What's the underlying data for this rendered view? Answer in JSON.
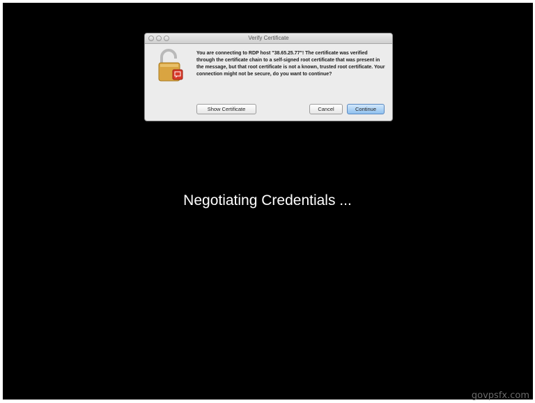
{
  "dialog": {
    "title": "Verify Certificate",
    "message": "You are connecting to RDP host \"38.65.25.77\"! The certificate was verified through the certificate chain to a self-signed root certificate that was present in the message, but that root certificate is not a known, trusted root certificate. Your connection might not be secure, do you want to continue?",
    "show_certificate_label": "Show Certificate",
    "cancel_label": "Cancel",
    "continue_label": "Continue",
    "icon": "unlocked-padlock-certificate-icon"
  },
  "status_text": "Negotiating Credentials ...",
  "watermark": "govpsfx.com",
  "colors": {
    "background": "#000000",
    "dialog_bg": "#ececec",
    "default_button": "#8fc0ef",
    "status_text": "#ffffff"
  }
}
